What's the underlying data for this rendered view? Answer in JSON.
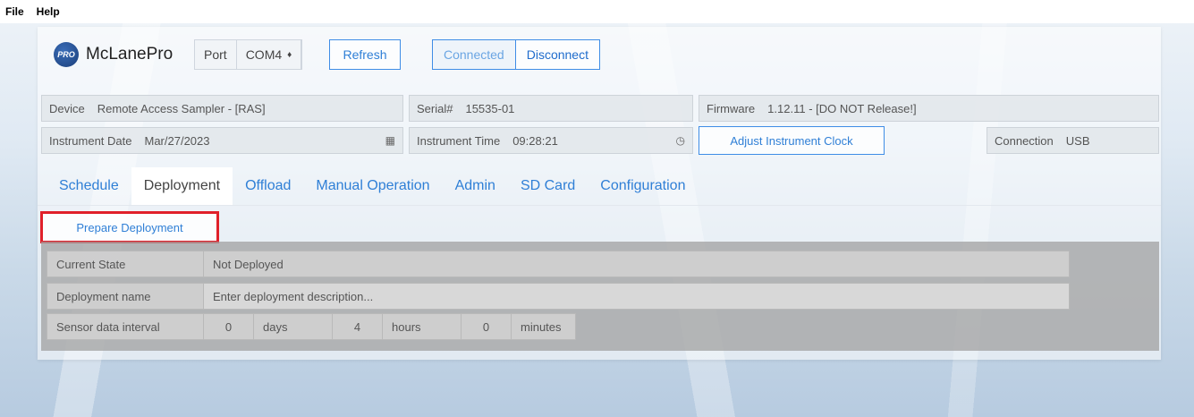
{
  "menu": {
    "file": "File",
    "help": "Help"
  },
  "brand": {
    "logo_text": "PRO",
    "name": "McLanePro"
  },
  "port": {
    "label": "Port",
    "value": "COM4",
    "select_arrow": "♦"
  },
  "buttons": {
    "refresh": "Refresh",
    "connected": "Connected",
    "disconnect": "Disconnect",
    "adjust_clock": "Adjust Instrument Clock",
    "prepare_deployment": "Prepare Deployment"
  },
  "info": {
    "device_label": "Device",
    "device_value": "Remote Access Sampler - [RAS]",
    "serial_label": "Serial#",
    "serial_value": "15535-01",
    "firmware_label": "Firmware",
    "firmware_value": "1.12.11 - [DO NOT Release!]",
    "date_label": "Instrument Date",
    "date_value": "Mar/27/2023",
    "time_label": "Instrument Time",
    "time_value": "09:28:21",
    "connection_label": "Connection",
    "connection_value": "USB"
  },
  "tabs": [
    {
      "label": "Schedule"
    },
    {
      "label": "Deployment"
    },
    {
      "label": "Offload"
    },
    {
      "label": "Manual Operation"
    },
    {
      "label": "Admin"
    },
    {
      "label": "SD Card"
    },
    {
      "label": "Configuration"
    }
  ],
  "deployment": {
    "state_label": "Current State",
    "state_value": "Not Deployed",
    "name_label": "Deployment name",
    "name_placeholder": "Enter deployment description...",
    "interval_label": "Sensor data interval",
    "days_value": "0",
    "days_unit": "days",
    "hours_value": "4",
    "hours_unit": "hours",
    "minutes_value": "0",
    "minutes_unit": "minutes"
  },
  "colors": {
    "accent": "#2f7fd6",
    "highlight": "#e0202a"
  }
}
